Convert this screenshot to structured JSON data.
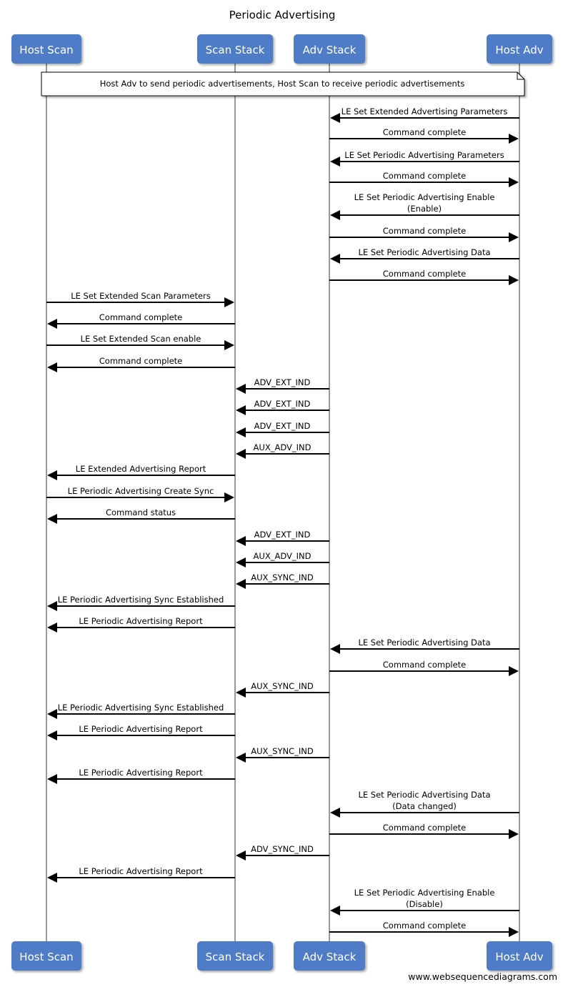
{
  "title": "Periodic Advertising",
  "watermark": "www.websequencediagrams.com",
  "colors": {
    "actor_fill": "#4f7bc6",
    "actor_text": "#ffffff",
    "lifeline": "#999999",
    "arrow": "#000000",
    "note_fill": "#ffffff",
    "note_border": "#000000"
  },
  "actors": [
    {
      "id": "host_scan",
      "label": "Host Scan"
    },
    {
      "id": "scan_stack",
      "label": "Scan Stack"
    },
    {
      "id": "adv_stack",
      "label": "Adv Stack"
    },
    {
      "id": "host_adv",
      "label": "Host Adv"
    }
  ],
  "note": {
    "text": "Host Adv to send periodic advertisements, Host Scan to receive periodic advertisements",
    "from": "host_scan",
    "to": "host_adv"
  },
  "messages": [
    {
      "from": "host_adv",
      "to": "adv_stack",
      "lines": [
        "LE Set Extended Advertising Parameters"
      ]
    },
    {
      "from": "adv_stack",
      "to": "host_adv",
      "lines": [
        "Command complete"
      ]
    },
    {
      "from": "host_adv",
      "to": "adv_stack",
      "lines": [
        "LE Set Periodic Advertising Parameters"
      ]
    },
    {
      "from": "adv_stack",
      "to": "host_adv",
      "lines": [
        "Command complete"
      ]
    },
    {
      "from": "host_adv",
      "to": "adv_stack",
      "lines": [
        "LE Set Periodic Advertising Enable",
        "(Enable)"
      ]
    },
    {
      "from": "adv_stack",
      "to": "host_adv",
      "lines": [
        "Command complete"
      ]
    },
    {
      "from": "host_adv",
      "to": "adv_stack",
      "lines": [
        "LE Set Periodic Advertising Data"
      ]
    },
    {
      "from": "adv_stack",
      "to": "host_adv",
      "lines": [
        "Command complete"
      ]
    },
    {
      "from": "host_scan",
      "to": "scan_stack",
      "lines": [
        "LE Set Extended Scan Parameters"
      ]
    },
    {
      "from": "scan_stack",
      "to": "host_scan",
      "lines": [
        "Command complete"
      ]
    },
    {
      "from": "host_scan",
      "to": "scan_stack",
      "lines": [
        "LE Set Extended Scan enable"
      ]
    },
    {
      "from": "scan_stack",
      "to": "host_scan",
      "lines": [
        "Command complete"
      ]
    },
    {
      "from": "adv_stack",
      "to": "scan_stack",
      "lines": [
        "ADV_EXT_IND"
      ]
    },
    {
      "from": "adv_stack",
      "to": "scan_stack",
      "lines": [
        "ADV_EXT_IND"
      ]
    },
    {
      "from": "adv_stack",
      "to": "scan_stack",
      "lines": [
        "ADV_EXT_IND"
      ]
    },
    {
      "from": "adv_stack",
      "to": "scan_stack",
      "lines": [
        "AUX_ADV_IND"
      ]
    },
    {
      "from": "scan_stack",
      "to": "host_scan",
      "lines": [
        "LE Extended Advertising Report"
      ]
    },
    {
      "from": "host_scan",
      "to": "scan_stack",
      "lines": [
        "LE Periodic Advertising Create Sync"
      ]
    },
    {
      "from": "scan_stack",
      "to": "host_scan",
      "lines": [
        "Command status"
      ]
    },
    {
      "from": "adv_stack",
      "to": "scan_stack",
      "lines": [
        "ADV_EXT_IND"
      ]
    },
    {
      "from": "adv_stack",
      "to": "scan_stack",
      "lines": [
        "AUX_ADV_IND"
      ]
    },
    {
      "from": "adv_stack",
      "to": "scan_stack",
      "lines": [
        "AUX_SYNC_IND"
      ]
    },
    {
      "from": "scan_stack",
      "to": "host_scan",
      "lines": [
        "LE Periodic Advertising Sync Established"
      ]
    },
    {
      "from": "scan_stack",
      "to": "host_scan",
      "lines": [
        "LE Periodic Advertising Report"
      ]
    },
    {
      "from": "host_adv",
      "to": "adv_stack",
      "lines": [
        "LE Set Periodic Advertising Data"
      ]
    },
    {
      "from": "adv_stack",
      "to": "host_adv",
      "lines": [
        "Command complete"
      ]
    },
    {
      "from": "adv_stack",
      "to": "scan_stack",
      "lines": [
        "AUX_SYNC_IND"
      ]
    },
    {
      "from": "scan_stack",
      "to": "host_scan",
      "lines": [
        "LE Periodic Advertising Sync Established"
      ]
    },
    {
      "from": "scan_stack",
      "to": "host_scan",
      "lines": [
        "LE Periodic Advertising Report"
      ]
    },
    {
      "from": "adv_stack",
      "to": "scan_stack",
      "lines": [
        "AUX_SYNC_IND"
      ]
    },
    {
      "from": "scan_stack",
      "to": "host_scan",
      "lines": [
        "LE Periodic Advertising Report"
      ]
    },
    {
      "from": "host_adv",
      "to": "adv_stack",
      "lines": [
        "LE Set Periodic Advertising Data",
        "(Data changed)"
      ]
    },
    {
      "from": "adv_stack",
      "to": "host_adv",
      "lines": [
        "Command complete"
      ]
    },
    {
      "from": "adv_stack",
      "to": "scan_stack",
      "lines": [
        "ADV_SYNC_IND"
      ]
    },
    {
      "from": "scan_stack",
      "to": "host_scan",
      "lines": [
        "LE Periodic Advertising Report"
      ]
    },
    {
      "from": "host_adv",
      "to": "adv_stack",
      "lines": [
        "LE Set Periodic Advertising Enable",
        "(Disable)"
      ]
    },
    {
      "from": "adv_stack",
      "to": "host_adv",
      "lines": [
        "Command complete"
      ]
    }
  ]
}
